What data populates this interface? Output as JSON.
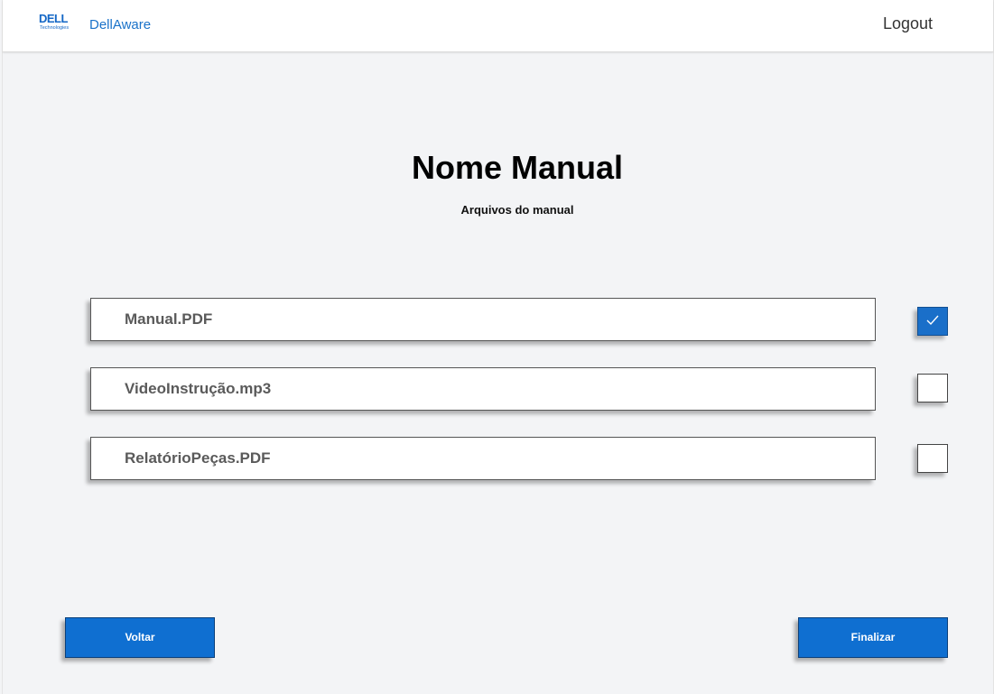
{
  "header": {
    "logo_text": "DELL",
    "logo_subtext": "Technologies",
    "brand": "DellAware",
    "logout_label": "Logout"
  },
  "main": {
    "title": "Nome Manual",
    "subtitle": "Arquivos do manual",
    "files": [
      {
        "name": "Manual.PDF",
        "checked": true
      },
      {
        "name": "VideoInstrução.mp3",
        "checked": false
      },
      {
        "name": "RelatórioPeças.PDF",
        "checked": false
      }
    ]
  },
  "footer": {
    "back_label": "Voltar",
    "finish_label": "Finalizar"
  },
  "colors": {
    "accent": "#0f6fd1",
    "brand": "#1467c6",
    "background": "#f3f4f6"
  }
}
